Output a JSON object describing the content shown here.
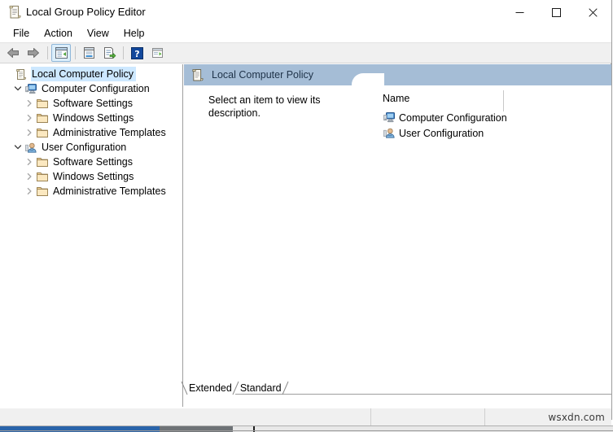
{
  "window": {
    "title": "Local Group Policy Editor",
    "title_icon": "policy-scroll-icon",
    "controls": {
      "minimize": "Minimize",
      "maximize": "Maximize",
      "close": "Close"
    }
  },
  "menubar": {
    "items": [
      {
        "label": "File"
      },
      {
        "label": "Action"
      },
      {
        "label": "View"
      },
      {
        "label": "Help"
      }
    ]
  },
  "toolbar": {
    "buttons": [
      {
        "name": "back-button",
        "icon": "left-arrow-icon",
        "tooltip": "Back"
      },
      {
        "name": "forward-button",
        "icon": "right-arrow-icon",
        "tooltip": "Forward"
      },
      {
        "name": "show-hide-tree-button",
        "icon": "tree-pane-icon",
        "tooltip": "Show/Hide Console Tree",
        "active": true
      },
      {
        "name": "properties-button",
        "icon": "properties-icon",
        "tooltip": "Properties"
      },
      {
        "name": "export-list-button",
        "icon": "export-list-icon",
        "tooltip": "Export List"
      },
      {
        "name": "help-button",
        "icon": "help-question-icon",
        "tooltip": "Help"
      },
      {
        "name": "show-hide-action-pane-button",
        "icon": "action-pane-icon",
        "tooltip": "Show/Hide Action Pane"
      }
    ]
  },
  "tree": {
    "nodes": [
      {
        "label": "Local Computer Policy",
        "icon": "policy-scroll-icon",
        "level": 0,
        "twisty": "none",
        "selected": true
      },
      {
        "label": "Computer Configuration",
        "icon": "computer-icon",
        "level": 1,
        "twisty": "expanded",
        "selected": false
      },
      {
        "label": "Software Settings",
        "icon": "folder-icon",
        "level": 2,
        "twisty": "collapsed",
        "selected": false
      },
      {
        "label": "Windows Settings",
        "icon": "folder-icon",
        "level": 2,
        "twisty": "collapsed",
        "selected": false
      },
      {
        "label": "Administrative Templates",
        "icon": "folder-icon",
        "level": 2,
        "twisty": "collapsed",
        "selected": false
      },
      {
        "label": "User Configuration",
        "icon": "user-icon",
        "level": 1,
        "twisty": "expanded",
        "selected": false
      },
      {
        "label": "Software Settings",
        "icon": "folder-icon",
        "level": 2,
        "twisty": "collapsed",
        "selected": false
      },
      {
        "label": "Windows Settings",
        "icon": "folder-icon",
        "level": 2,
        "twisty": "collapsed",
        "selected": false
      },
      {
        "label": "Administrative Templates",
        "icon": "folder-icon",
        "level": 2,
        "twisty": "collapsed",
        "selected": false
      }
    ]
  },
  "detail": {
    "header_title": "Local Computer Policy",
    "header_icon": "policy-scroll-icon",
    "description": "Select an item to view its description.",
    "column_header": "Name",
    "items": [
      {
        "label": "Computer Configuration",
        "icon": "computer-icon"
      },
      {
        "label": "User Configuration",
        "icon": "user-icon"
      }
    ],
    "tabs": [
      {
        "label": "Extended",
        "selected": true
      },
      {
        "label": "Standard",
        "selected": false
      }
    ]
  },
  "statusbar": {
    "main": "",
    "middle": "",
    "watermark": "wsxdn.com"
  }
}
